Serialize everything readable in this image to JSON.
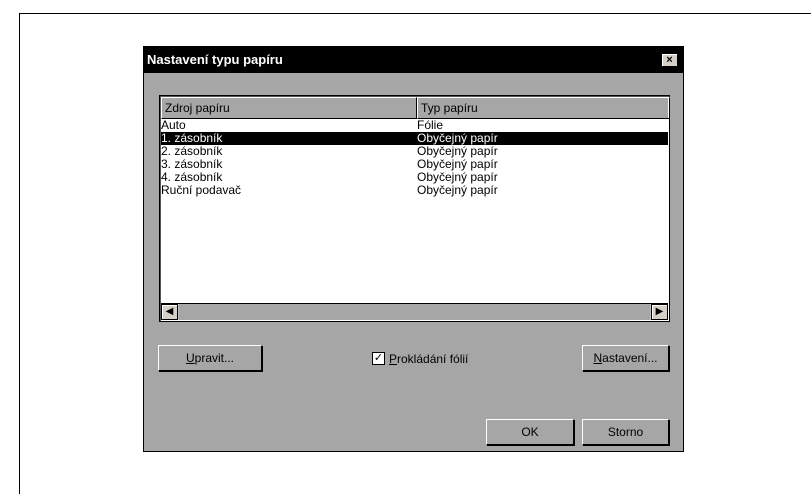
{
  "dialog": {
    "title": "Nastavení typu papíru",
    "close_glyph": "×",
    "columns": [
      "Zdroj papíru",
      "Typ papíru"
    ],
    "rows": [
      {
        "source": "Auto",
        "type": "Fólie",
        "selected": false
      },
      {
        "source": "1. zásobník",
        "type": "Obyčejný papír",
        "selected": true
      },
      {
        "source": "2. zásobník",
        "type": "Obyčejný papír",
        "selected": false
      },
      {
        "source": "3. zásobník",
        "type": "Obyčejný papír",
        "selected": false
      },
      {
        "source": "4. zásobník",
        "type": "Obyčejný papír",
        "selected": false
      },
      {
        "source": "Ruční podavač",
        "type": "Obyčejný papír",
        "selected": false
      }
    ],
    "scroll_left_glyph": "◀",
    "scroll_right_glyph": "▶",
    "edit_button": {
      "mnemonic": "U",
      "rest": "pravit..."
    },
    "checkbox": {
      "checked": true,
      "mark": "✓",
      "mnemonic": "P",
      "rest": "rokládání fólií"
    },
    "settings_button": {
      "mnemonic": "N",
      "rest": "astavení..."
    },
    "ok_label": "OK",
    "cancel_label": "Storno"
  }
}
